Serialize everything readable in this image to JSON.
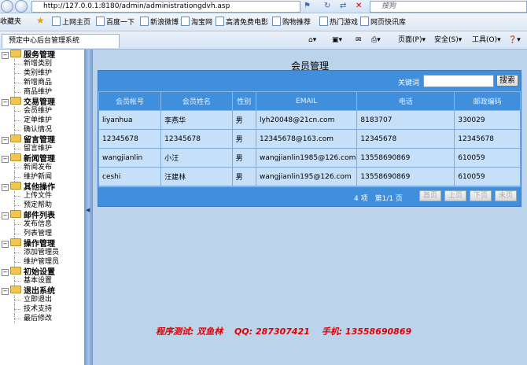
{
  "browser": {
    "url": "http://127.0.0.1:8180/admin/administrationgdvh.asp",
    "search_placeholder": "搜狗",
    "favorites_label": "收藏夹",
    "favorites": [
      "上网主页",
      "百度一下",
      "新浪微博",
      "淘宝网",
      "高清免费电影",
      "购物推荐",
      "热门游戏",
      "网页快讯库"
    ],
    "tab_title": "预定中心后台管理系统",
    "commands": [
      "页面(P)",
      "安全(S)",
      "工具(O)"
    ]
  },
  "sidebar": {
    "groups": [
      {
        "label": "服务管理",
        "items": [
          "新增类别",
          "类别维护",
          "新增商品",
          "商品维护"
        ]
      },
      {
        "label": "交易管理",
        "items": [
          "会员维护",
          "定单维护",
          "确认情况"
        ]
      },
      {
        "label": "留言管理",
        "items": [
          "留言维护"
        ]
      },
      {
        "label": "新闻管理",
        "items": [
          "新闻发布",
          "维护新闻"
        ]
      },
      {
        "label": "其他操作",
        "items": [
          "上传文件",
          "预定帮助"
        ]
      },
      {
        "label": "邮件列表",
        "items": [
          "发布信息",
          "列表管理"
        ]
      },
      {
        "label": "操作管理",
        "items": [
          "添加管理员",
          "维护管理员"
        ]
      },
      {
        "label": "初始设置",
        "items": [
          "基本设置"
        ]
      },
      {
        "label": "退出系统",
        "items": [
          "立即退出",
          "技术支持",
          "最后修改"
        ]
      }
    ]
  },
  "main": {
    "title": "会员管理",
    "search_label": "关键词",
    "search_button": "搜索",
    "columns": [
      "会员帐号",
      "会员姓名",
      "性别",
      "EMAIL",
      "电话",
      "邮政编码"
    ],
    "rows": [
      [
        "liyanhua",
        "李燕华",
        "男",
        "lyh20048@21cn.com",
        "8183707",
        "330029"
      ],
      [
        "12345678",
        "12345678",
        "男",
        "12345678@163.com",
        "12345678",
        "12345678"
      ],
      [
        "wangjianlin",
        "小汪",
        "男",
        "wangjianlin1985@126.com",
        "13558690869",
        "610059"
      ],
      [
        "ceshi",
        "汪建林",
        "男",
        "wangjianlin195@126.com",
        "13558690869",
        "610059"
      ]
    ],
    "pager": {
      "info": "4 项　第1/1 页",
      "first": "首页",
      "prev": "上页",
      "next": "下页",
      "last": "末页"
    },
    "footer": "程序测试: 双鱼林　 QQ: 287307421　  手机: 13558690869"
  }
}
